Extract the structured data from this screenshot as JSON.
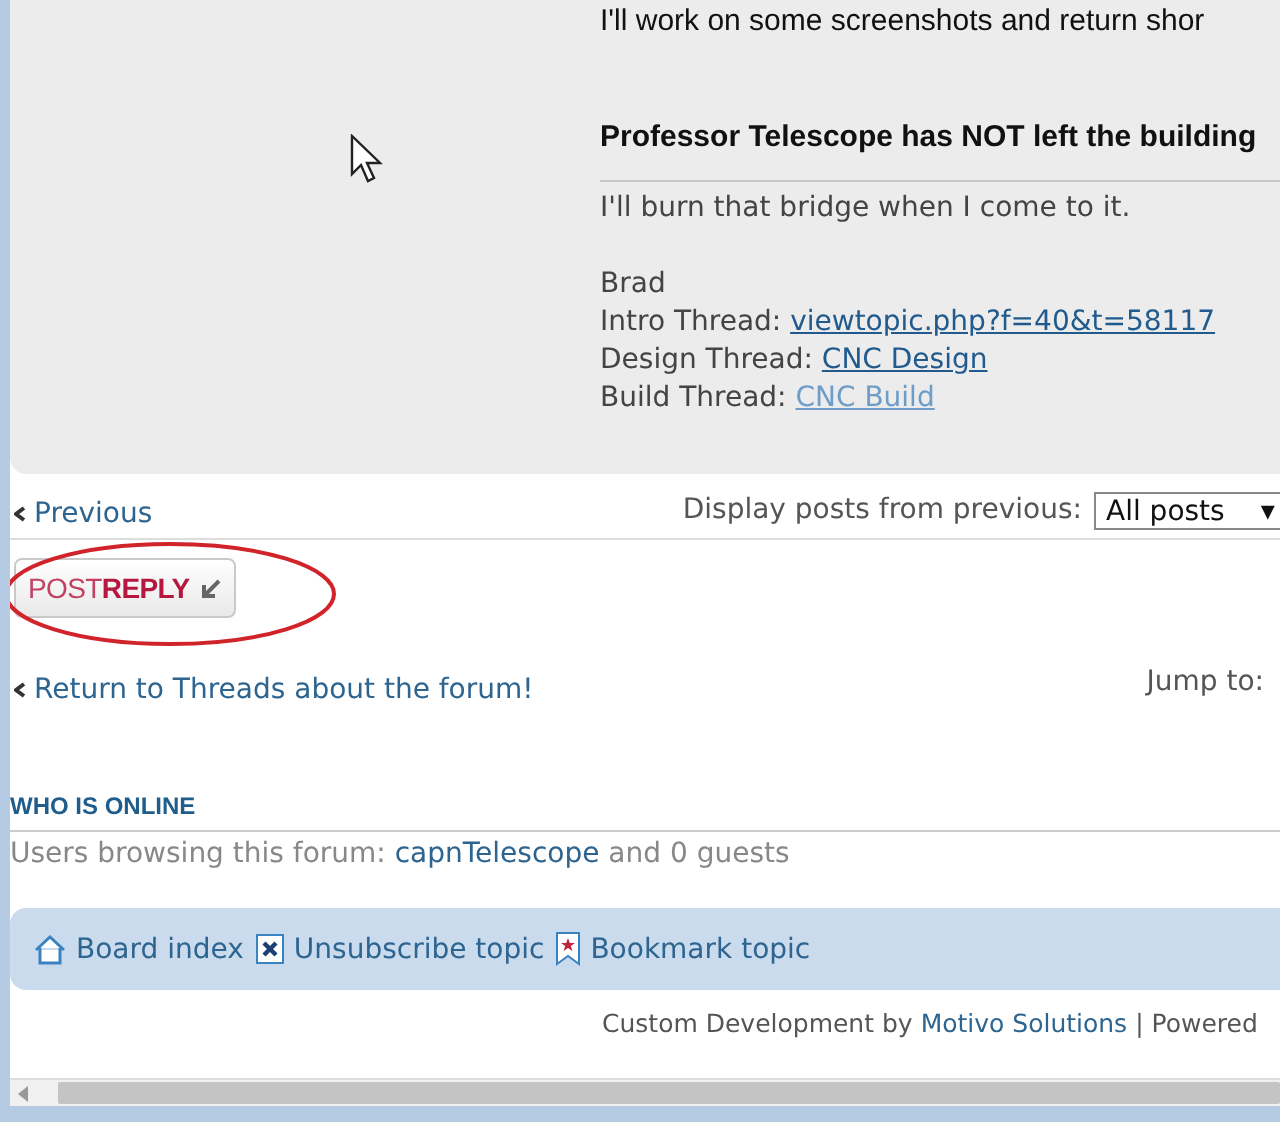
{
  "post": {
    "body_line": "I'll work on some screenshots and return shor",
    "bold_line": "Professor Telescope has NOT left the building",
    "signature": {
      "quote": "I'll burn that bridge when I come to it.",
      "name": "Brad",
      "threads": [
        {
          "label": "Intro Thread:",
          "link": "viewtopic.php?f=40&t=58117",
          "visited": false
        },
        {
          "label": "Design Thread:",
          "link": "CNC Design",
          "visited": false
        },
        {
          "label": "Build Thread:",
          "link": "CNC Build",
          "visited": true
        }
      ]
    }
  },
  "pagination": {
    "previous": "Previous",
    "display_label": "Display posts from previous:",
    "display_value": "All posts",
    "dropdown_arrow": "▾"
  },
  "post_reply": {
    "part1": "POST",
    "part2": "REPLY"
  },
  "return_link": "Return to Threads about the forum!",
  "jump_to": "Jump to:",
  "who_is_online": {
    "title": "WHO IS ONLINE",
    "prefix": "Users browsing this forum:",
    "user": "capnTelescope",
    "suffix": "and 0 guests"
  },
  "navbar": [
    {
      "kind": "home",
      "label": "Board index"
    },
    {
      "kind": "unsubscribe",
      "label": "Unsubscribe topic"
    },
    {
      "kind": "bookmark",
      "label": "Bookmark topic"
    }
  ],
  "footer": {
    "prefix": "Custom Development by",
    "link": "Motivo Solutions",
    "suffix": "| Powered"
  }
}
